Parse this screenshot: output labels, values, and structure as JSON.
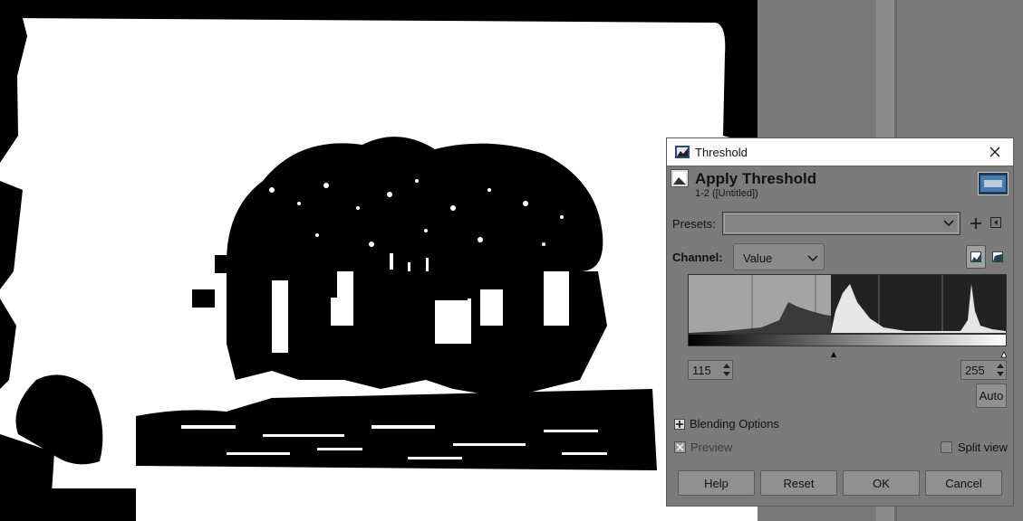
{
  "dialog": {
    "window_title": "Threshold",
    "header_title": "Apply Threshold",
    "header_subtitle": "1-2 ([Untitled])",
    "presets_label": "Presets:",
    "presets_value": "",
    "channel_label": "Channel:",
    "channel_value": "Value",
    "low_value": "115",
    "high_value": "255",
    "auto_label": "Auto",
    "blending_options_label": "Blending Options",
    "preview_label": "Preview",
    "preview_checked": true,
    "split_view_label": "Split view",
    "split_view_checked": false,
    "buttons": {
      "help": "Help",
      "reset": "Reset",
      "ok": "OK",
      "cancel": "Cancel"
    }
  },
  "icons": [
    "threshold-app-icon",
    "close-icon",
    "chevron-down-icon",
    "plus-icon",
    "collapse-icon",
    "linear-histogram-icon",
    "log-histogram-icon",
    "spin-arrows-icon",
    "expand-plus-icon",
    "checkbox-x-icon"
  ],
  "colors": {
    "canvas_bg": "#000000",
    "dialog_bg": "#7b7b7b",
    "titlebar_bg": "#ffffff",
    "gutter": "#787878"
  }
}
